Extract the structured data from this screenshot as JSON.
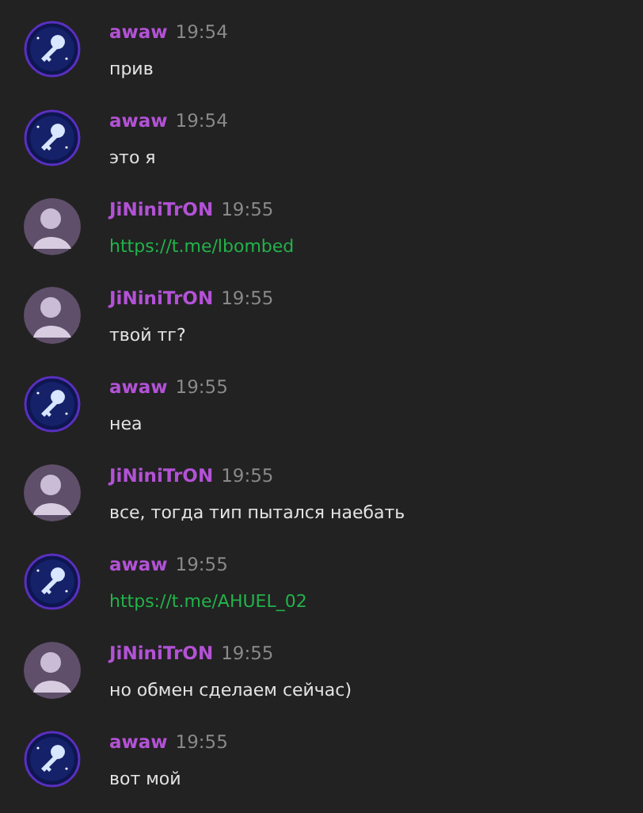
{
  "messages": [
    {
      "author": "awaw",
      "avatar": {
        "kind": "key"
      },
      "time": "19:54",
      "kind": "text",
      "text": "прив"
    },
    {
      "author": "awaw",
      "avatar": {
        "kind": "key"
      },
      "time": "19:54",
      "kind": "text",
      "text": "это я"
    },
    {
      "author": "JiNiniTrON",
      "avatar": {
        "kind": "figure"
      },
      "time": "19:55",
      "kind": "link",
      "text": "https://t.me/lbombed"
    },
    {
      "author": "JiNiniTrON",
      "avatar": {
        "kind": "figure"
      },
      "time": "19:55",
      "kind": "text",
      "text": "твой тг?"
    },
    {
      "author": "awaw",
      "avatar": {
        "kind": "key"
      },
      "time": "19:55",
      "kind": "text",
      "text": "неа"
    },
    {
      "author": "JiNiniTrON",
      "avatar": {
        "kind": "figure"
      },
      "time": "19:55",
      "kind": "text",
      "text": "все, тогда тип пытался наебать"
    },
    {
      "author": "awaw",
      "avatar": {
        "kind": "key"
      },
      "time": "19:55",
      "kind": "link",
      "text": "https://t.me/AHUEL_02"
    },
    {
      "author": "JiNiniTrON",
      "avatar": {
        "kind": "figure"
      },
      "time": "19:55",
      "kind": "text",
      "text": "но обмен сделаем сейчас)"
    },
    {
      "author": "awaw",
      "avatar": {
        "kind": "key"
      },
      "time": "19:55",
      "kind": "text",
      "text": "вот мой"
    }
  ]
}
